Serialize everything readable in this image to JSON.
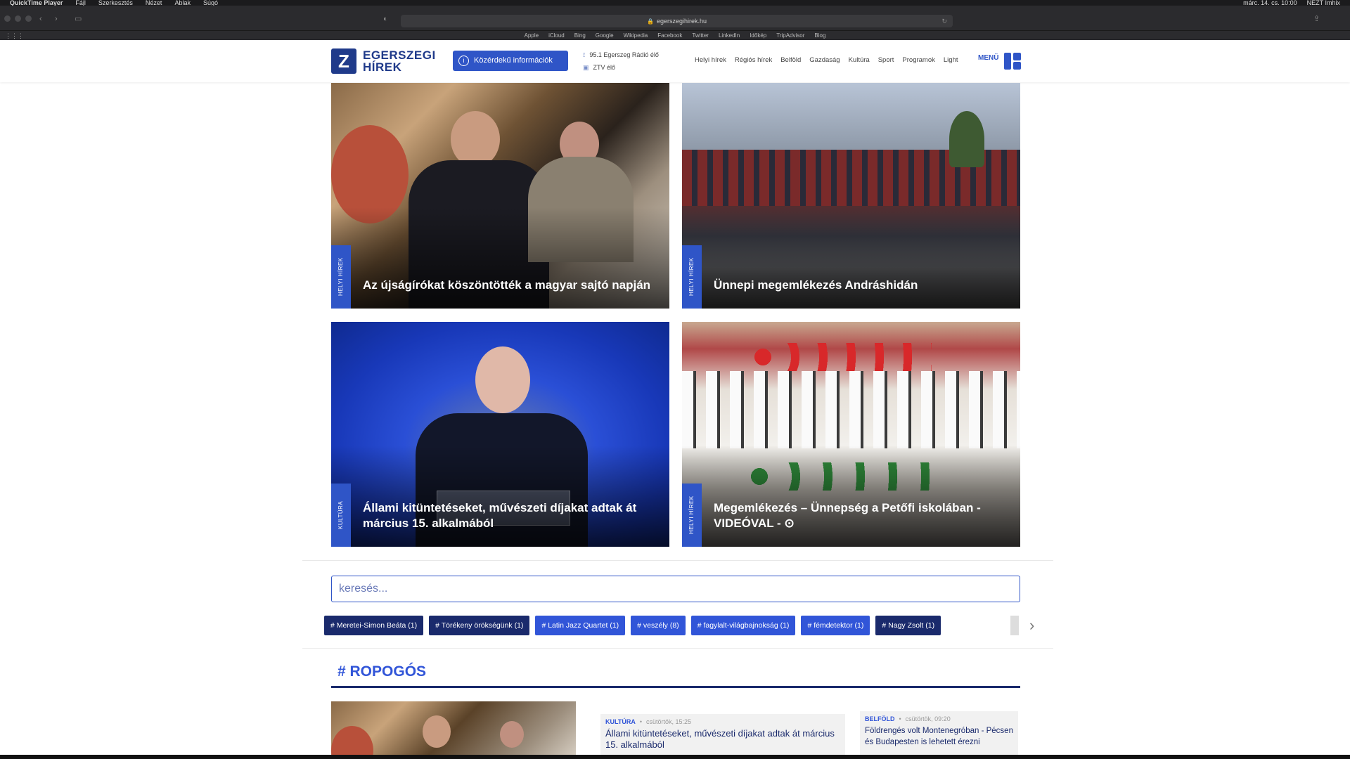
{
  "mac_menubar": {
    "app": "QuickTime Player",
    "items": [
      "Fájl",
      "Szerkesztés",
      "Nézet",
      "Ablak",
      "Súgó"
    ],
    "clock": "márc. 14. cs. 10:00",
    "user": "NÉZT Imhix"
  },
  "browser": {
    "url": "egerszegihirek.hu",
    "favorites": [
      "Apple",
      "iCloud",
      "Bing",
      "Google",
      "Wikipedia",
      "Facebook",
      "Twitter",
      "LinkedIn",
      "Időkép",
      "TripAdvisor",
      "Blog"
    ]
  },
  "header": {
    "logo_line1": "EGERSZEGI",
    "logo_line2": "HÍREK",
    "info_button": "Közérdekű információk",
    "radio_link": "95.1 Egerszeg Rádió élő",
    "tv_link": "ZTV élő",
    "nav": [
      "Helyi hírek",
      "Régiós hírek",
      "Belföld",
      "Gazdaság",
      "Kultúra",
      "Sport",
      "Programok",
      "Light"
    ],
    "menu_label": "MENÜ"
  },
  "featured": [
    {
      "tag": "HELYI HÍREK",
      "title": "Az újságírókat köszöntötték a magyar sajtó napján"
    },
    {
      "tag": "HELYI HÍREK",
      "title": "Ünnepi megemlékezés Andráshidán"
    },
    {
      "tag": "KULTÚRA",
      "title": "Állami kitüntetéseket, művészeti díjakat adtak át március 15. alkalmából"
    },
    {
      "tag": "HELYI HÍREK",
      "title": "Megemlékezés – Ünnepség a Petőfi iskolában - VIDEÓVAL -"
    }
  ],
  "search": {
    "placeholder": "keresés..."
  },
  "tags": [
    "# Meretei-Simon Beáta (1)",
    "# Törékeny örökségünk (1)",
    "# Latin Jazz Quartet (1)",
    "# veszély (8)",
    "# fagylalt-világbajnokság (1)",
    "# fémdetektor (1)",
    "# Nagy Zsolt (1)"
  ],
  "section": {
    "title": "# ROPOGÓS"
  },
  "news": [
    {
      "category": "KULTÚRA",
      "time": "csütörtök, 15:25",
      "headline": "Állami kitüntetéseket, művészeti díjakat adtak át március 15. alkalmából"
    },
    {
      "category": "BELFÖLD",
      "time": "csütörtök, 09:20",
      "headline": "Földrengés volt Montenegróban - Pécsen és Budapesten is lehetett érezni"
    }
  ],
  "colors": {
    "brand_dark": "#1a2a6c",
    "brand_blue": "#3155d8"
  }
}
